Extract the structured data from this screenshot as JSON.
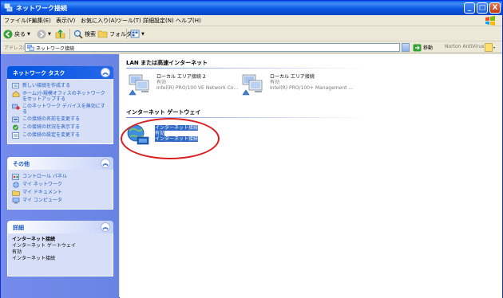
{
  "window": {
    "title": "ネットワーク接続",
    "buttons": {
      "minimize": "_",
      "maximize": "□",
      "close": "X"
    }
  },
  "menu": [
    "ファイル(F)",
    "編集(E)",
    "表示(V)",
    "お気に入り(A)",
    "ツール(T)",
    "詳細設定(N)",
    "ヘルプ(H)"
  ],
  "toolbar": {
    "back": "戻る",
    "search": "検索",
    "folders": "フォルダ"
  },
  "address": {
    "label": "アドレス(D)",
    "value": "ネットワーク接続",
    "go": "移動",
    "norton": "Norton AntiVirus"
  },
  "taskpane": {
    "network_tasks": {
      "title": "ネットワーク タスク",
      "items": [
        "新しい接続を作成する",
        "ホーム/小規模オフィスのネットワークをセットアップする",
        "このネットワーク デバイスを無効にする",
        "この接続の名前を変更する",
        "この接続の状況を表示する",
        "この接続の設定を変更する"
      ]
    },
    "other_places": {
      "title": "その他",
      "items": [
        "コントロール パネル",
        "マイ ネットワーク",
        "マイ ドキュメント",
        "マイ コンピュータ"
      ]
    },
    "details": {
      "title": "詳細",
      "name": "インターネット接続",
      "lines": [
        "インターネット ゲートウェイ",
        "有効",
        "インターネット接続"
      ]
    }
  },
  "content": {
    "groups": [
      {
        "title": "LAN または高速インターネット",
        "connections": [
          {
            "name": "ローカル エリア接続 2",
            "status": "有効",
            "device": "Intel(R) PRO/100 VE Network Co..."
          },
          {
            "name": "ローカル エリア接続",
            "status": "有効",
            "device": "Intel(R) PRO/100+ Management ..."
          }
        ]
      },
      {
        "title": "インターネット ゲートウェイ",
        "connections": [
          {
            "name": "インターネット接続",
            "status": "有効",
            "device": "インターネット接続"
          }
        ]
      }
    ]
  },
  "colors": {
    "title_bar": "#0a58e2",
    "task_pane": "#6884e3",
    "link": "#215dc6",
    "selection": "#316ac5",
    "annotation": "#d81e1e"
  }
}
